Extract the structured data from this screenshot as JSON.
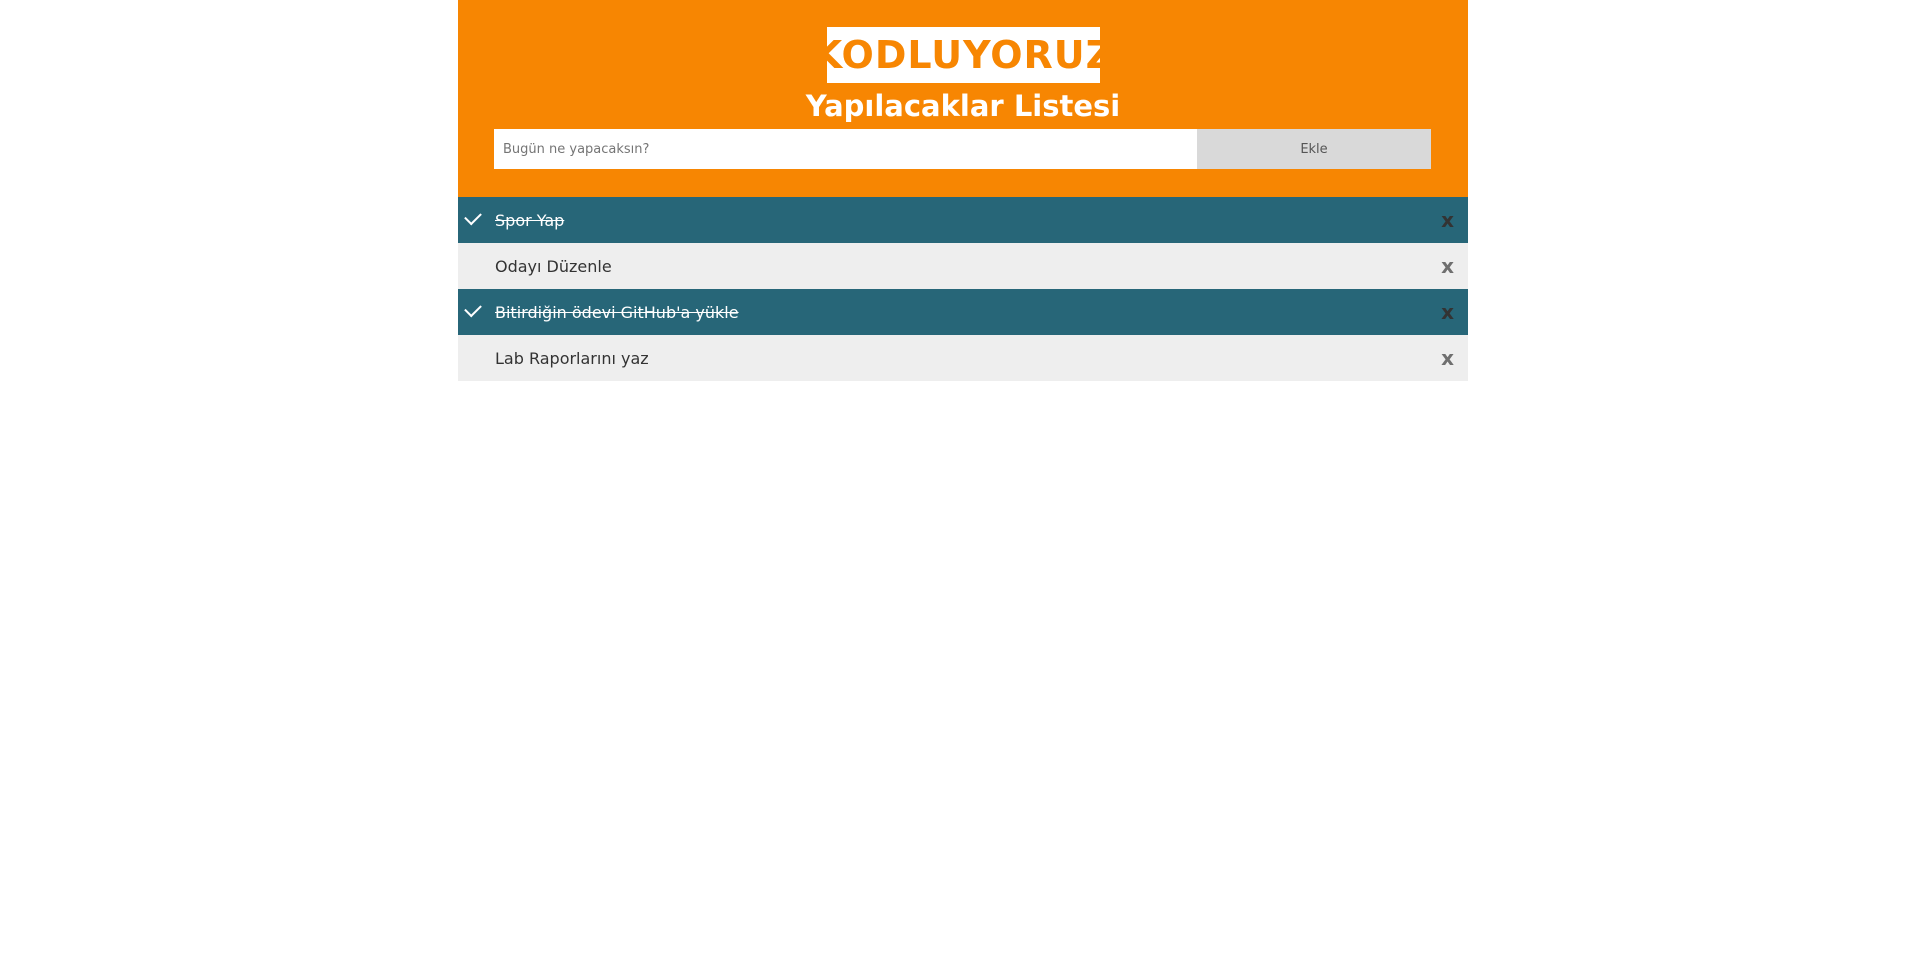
{
  "header": {
    "logo_text": "KODLUYORUZ",
    "title": "Yapılacaklar Listesi"
  },
  "form": {
    "input_placeholder": "Bugün ne yapacaksın?",
    "input_value": "",
    "add_button_label": "Ekle"
  },
  "tasks": [
    {
      "label": "Spor Yap",
      "checked": true,
      "close_label": "x"
    },
    {
      "label": "Odayı Düzenle",
      "checked": false,
      "close_label": "x"
    },
    {
      "label": "Bitirdiğin ödevi GitHub'a yükle",
      "checked": true,
      "close_label": "x"
    },
    {
      "label": "Lab Raporlarını yaz",
      "checked": false,
      "close_label": "x"
    }
  ],
  "colors": {
    "header_bg": "#f78602",
    "checked_bg": "#276678",
    "unchecked_bg": "#eeeeee",
    "button_bg": "#d9d9d9"
  },
  "icons": {
    "check": "check-icon",
    "close": "close-icon"
  }
}
